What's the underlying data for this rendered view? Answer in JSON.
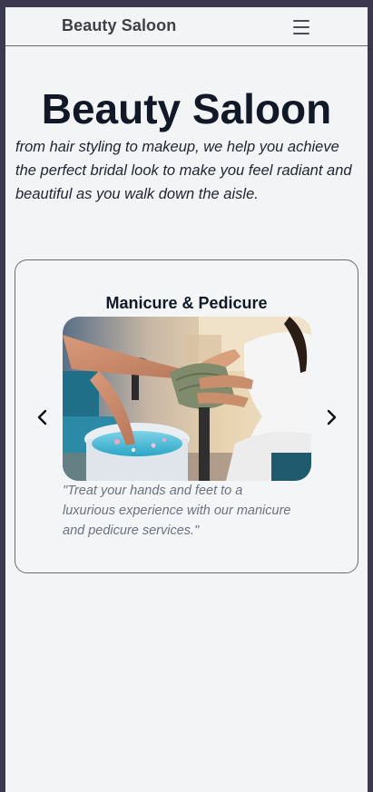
{
  "navbar": {
    "brand": "Beauty Saloon",
    "menu_icon": "hamburger-menu-icon"
  },
  "hero": {
    "title": "Beauty Saloon",
    "subtitle": "from hair styling to makeup, we help you achieve the perfect bridal look to make you feel radiant and beautiful as you walk down the aisle."
  },
  "carousel": {
    "title": "Manicure & Pedicure",
    "image_alt": "Manicure & Pedicure",
    "caption": "\"Treat your hands and feet to a luxurious experience with our manicure and pedicure services.\"",
    "prev_icon": "chevron-left-icon",
    "next_icon": "chevron-right-icon"
  },
  "colors": {
    "page_background": "#f3f4f6",
    "outer_background": "#3b3850",
    "heading": "#111827",
    "caption": "#6b7280",
    "border": "#6b6b6b"
  }
}
